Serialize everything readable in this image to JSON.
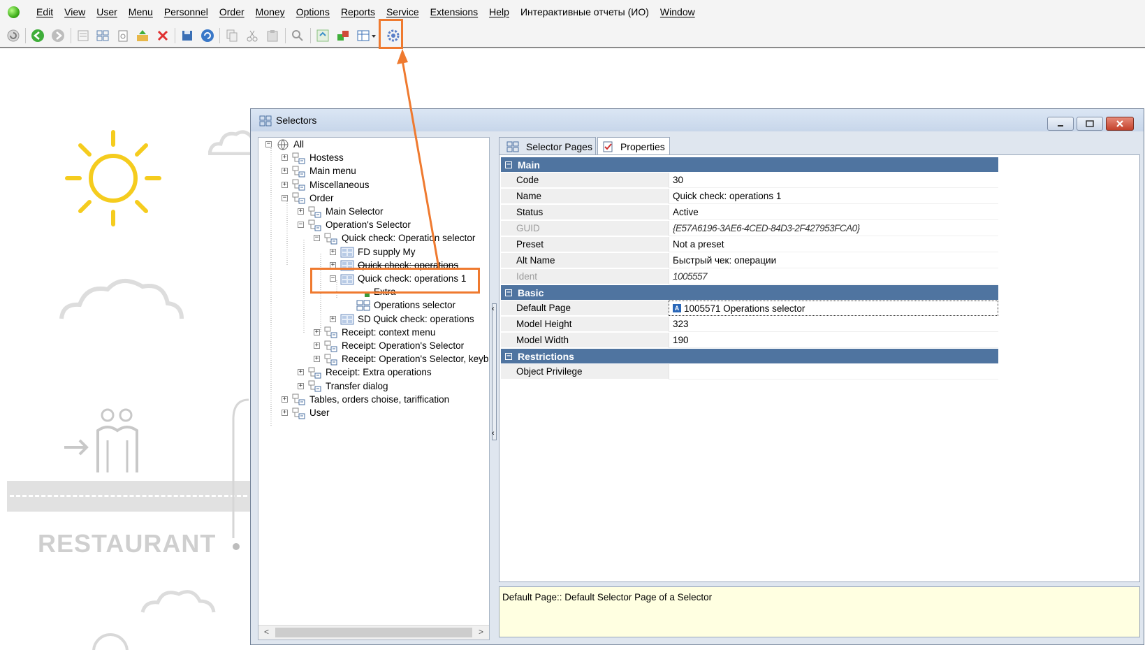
{
  "menubar": {
    "items": [
      "Edit",
      "View",
      "User",
      "Menu",
      "Personnel",
      "Order",
      "Money",
      "Options",
      "Reports",
      "Service",
      "Extensions",
      "Help",
      "Интерактивные отчеты (ИО)",
      "Window"
    ]
  },
  "toolbar": {
    "buttons": [
      "refresh-icon",
      "back-icon",
      "forward-icon",
      "page-icon",
      "grid-icon",
      "copy-doc-icon",
      "export-icon",
      "delete-icon",
      "save-icon",
      "undo-icon",
      "copy-icon",
      "cut-icon",
      "paste-icon",
      "find-icon",
      "sync-icon",
      "move-icon",
      "table-view-icon",
      "selectors-gear-icon"
    ]
  },
  "background": {
    "restaurant": "RESTAURANT"
  },
  "window": {
    "title": "Selectors"
  },
  "tree": {
    "rows": [
      {
        "label": "All",
        "toggle": "−"
      },
      {
        "label": "Hostess",
        "toggle": "+"
      },
      {
        "label": "Main menu",
        "toggle": "+"
      },
      {
        "label": "Miscellaneous",
        "toggle": "+"
      },
      {
        "label": "Order",
        "toggle": "−"
      },
      {
        "label": "Main Selector",
        "toggle": "+"
      },
      {
        "label": "Operation's Selector",
        "toggle": "−"
      },
      {
        "label": "Quick check: Operation selector",
        "toggle": "−"
      },
      {
        "label": "FD supply My",
        "toggle": "+"
      },
      {
        "label": "Quick check: operations",
        "toggle": "+"
      },
      {
        "label": "Quick check: operations 1",
        "toggle": "−"
      },
      {
        "label": "Extra",
        "toggle": ""
      },
      {
        "label": "Operations selector",
        "toggle": ""
      },
      {
        "label": "SD Quick check: operations",
        "toggle": "+"
      },
      {
        "label": "Receipt: context menu",
        "toggle": "+"
      },
      {
        "label": "Receipt: Operation's Selector",
        "toggle": "+"
      },
      {
        "label": "Receipt: Operation's Selector, keyboa",
        "toggle": "+"
      },
      {
        "label": "Receipt: Extra operations",
        "toggle": "+"
      },
      {
        "label": "Transfer dialog",
        "toggle": "+"
      },
      {
        "label": "Tables, orders choise, tariffication",
        "toggle": "+"
      },
      {
        "label": "User",
        "toggle": "+"
      }
    ]
  },
  "tabs": {
    "selector_pages": "Selector Pages",
    "properties": "Properties"
  },
  "properties": {
    "main": {
      "title": "Main",
      "code_label": "Code",
      "code_value": "30",
      "name_label": "Name",
      "name_value": "Quick check: operations 1",
      "status_label": "Status",
      "status_value": "Active",
      "guid_label": "GUID",
      "guid_value": "{E57A6196-3AE6-4CED-84D3-2F427953FCA0}",
      "preset_label": "Preset",
      "preset_value": "Not a preset",
      "altname_label": "Alt Name",
      "altname_value": "Быстрый чек: операции",
      "ident_label": "Ident",
      "ident_value": "1005557"
    },
    "basic": {
      "title": "Basic",
      "default_page_label": "Default Page",
      "default_page_value": "1005571 Operations selector",
      "model_height_label": "Model Height",
      "model_height_value": "323",
      "model_width_label": "Model Width",
      "model_width_value": "190"
    },
    "restrictions": {
      "title": "Restrictions",
      "object_privilege_label": "Object Privilege",
      "object_privilege_value": ""
    }
  },
  "description": "Default Page:: Default Selector Page of a Selector",
  "colors": {
    "accent_highlight": "#ef7a2f",
    "category_header": "#4f74a0",
    "description_bg": "#ffffe1"
  }
}
